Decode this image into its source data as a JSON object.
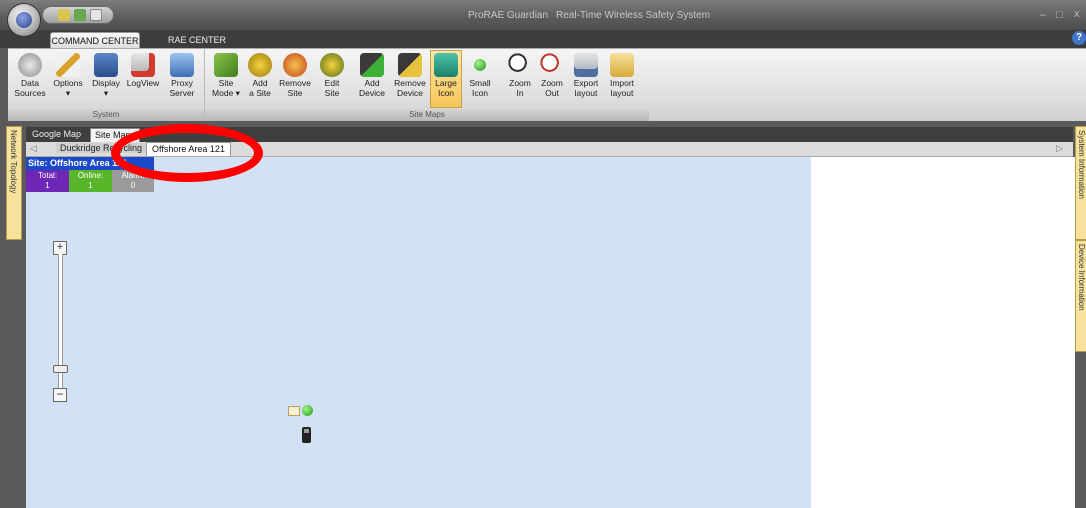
{
  "titlebar": {
    "app_name": "ProRAE Guardian",
    "subtitle": "Real-Time Wireless Safety System",
    "minimize": "–",
    "maximize": "□",
    "close": "x"
  },
  "ribbon_tabs": [
    "COMMAND CENTER",
    "RAE CENTER"
  ],
  "help_label": "?",
  "ribbon": {
    "system_group": {
      "label": "System",
      "buttons": [
        {
          "line1": "Data",
          "line2": "Sources"
        },
        {
          "line1": "Options",
          "line2": "▾"
        },
        {
          "line1": "Display",
          "line2": "▾"
        },
        {
          "line1": "LogView",
          "line2": ""
        },
        {
          "line1": "Proxy",
          "line2": "Server"
        }
      ]
    },
    "sitemaps_group": {
      "label": "Site Maps",
      "buttons": [
        {
          "line1": "Site",
          "line2": "Mode ▾"
        },
        {
          "line1": "Add",
          "line2": "a Site"
        },
        {
          "line1": "Remove",
          "line2": "Site"
        },
        {
          "line1": "Edit",
          "line2": "Site"
        },
        {
          "line1": "Add",
          "line2": "Device"
        },
        {
          "line1": "Remove",
          "line2": "Device"
        },
        {
          "line1": "Large",
          "line2": "Icon"
        },
        {
          "line1": "Small",
          "line2": "Icon"
        },
        {
          "line1": "Zoom",
          "line2": "In"
        },
        {
          "line1": "Zoom",
          "line2": "Out"
        },
        {
          "line1": "Export",
          "line2": "layout"
        },
        {
          "line1": "Import",
          "line2": "layout"
        }
      ]
    }
  },
  "side_tabs": {
    "left": "Network Topology",
    "right_top": "System Information",
    "right_bottom": "Device Information"
  },
  "view_tabs": [
    "Google Map",
    "Site Maps"
  ],
  "site_tabs": [
    "Duckridge Recycling",
    "Offshore Area 121"
  ],
  "site_panel": {
    "header": "Site: Offshore Area 121",
    "total_label": "Total:",
    "total_value": "1",
    "online_label": "Online:",
    "online_value": "1",
    "alarm_label": "Alarm:",
    "alarm_value": "0"
  },
  "zoom_control": {
    "plus": "+",
    "minus": "−"
  },
  "colors": {
    "map_background": "#d3e1f5",
    "site_header": "#1b49c7",
    "total_badge": "#6e27b7",
    "online_badge": "#59b62a",
    "alarm_badge": "#9a9a9a",
    "annotation": "#ff0000"
  }
}
